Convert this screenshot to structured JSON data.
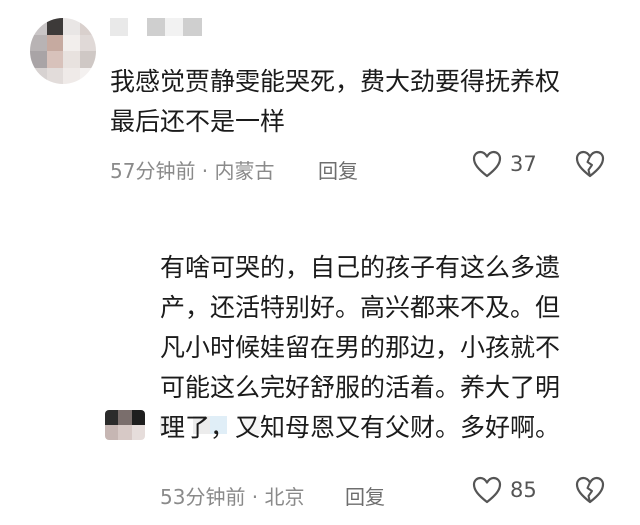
{
  "comments": [
    {
      "text_lines": [
        "我感觉贾静雯能哭死，费大劲要得抚养权",
        "最后还不是一样"
      ],
      "time_location": "57分钟前 · 内蒙古",
      "reply_label": "回复",
      "like_count": "37",
      "mosaic_avatar_colors": [
        "#c9c5c6",
        "#3d3a39",
        "#e9e6e5",
        "#d9d0cd",
        "#b8b3b4",
        "#c6aaa0",
        "#f2eeec",
        "#e0d9d7",
        "#a9a4a6",
        "#d8c2bb",
        "#e8e2df",
        "#cfc8c5",
        "#d7d2d1",
        "#e2dcda",
        "#efeae8",
        "#f4f1f0"
      ],
      "mosaic_name_colors": [
        "#e9e9e9",
        "#ffffff",
        "#cfcfcf",
        "#f2f2f2",
        "#cfcfcf",
        "#ffffff"
      ]
    },
    {
      "text_lines": [
        "有啥可哭的，自己的孩子有这么多遗",
        "产，还活特别好。高兴都来不及。但",
        "凡小时候娃留在男的那边，小孩就不",
        "可能这么完好舒服的活着。养大了明",
        "理了，又知母恩又有父财。多好啊。"
      ],
      "time_location": "53分钟前 · 北京",
      "reply_label": "回复",
      "like_count": "85",
      "mosaic_avatar_colors": [
        "#2b2b2b",
        "#7a6e6c",
        "#1e1e1e",
        "#c6b6b3",
        "#d7c9c6",
        "#e6dddb"
      ],
      "mosaic_name_colors": [
        "#ececec",
        "#ffffff",
        "#ececec",
        "#e0eef7",
        "#ffffff",
        "#f4f4f4"
      ]
    }
  ]
}
